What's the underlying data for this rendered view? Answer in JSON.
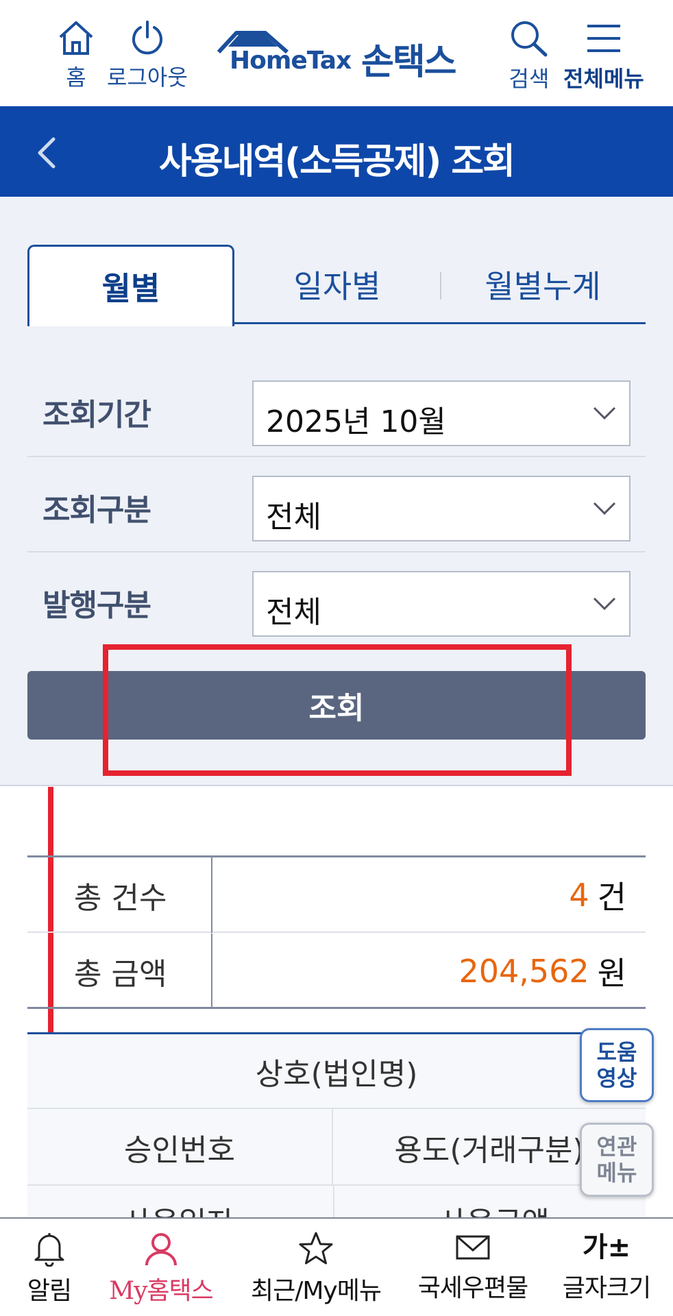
{
  "header": {
    "home_label": "홈",
    "logout_label": "로그아웃",
    "logo_text": "HomeTax",
    "logo_kr": "손택스",
    "search_label": "검색",
    "menu_label": "전체메뉴"
  },
  "title_bar": {
    "title": "사용내역(소득공제) 조회"
  },
  "tabs": [
    {
      "label": "월별",
      "active": true
    },
    {
      "label": "일자별",
      "active": false
    },
    {
      "label": "월별누계",
      "active": false
    }
  ],
  "filters": {
    "period": {
      "label": "조회기간",
      "value": "2025년 10월"
    },
    "type": {
      "label": "조회구분",
      "value": "전체"
    },
    "issue": {
      "label": "발행구분",
      "value": "전체"
    }
  },
  "search_button": "조회",
  "summary": {
    "count_label": "총 건수",
    "count_value": "4",
    "count_unit": "건",
    "amount_label": "총 금액",
    "amount_value": "204,562",
    "amount_unit": "원"
  },
  "list_header": {
    "merchant": "상호(법인명)",
    "approval_no": "승인번호",
    "usage": "용도(거래구분)",
    "used_date": "사용일자",
    "used_amount": "사용금액"
  },
  "floating": {
    "help_line1": "도움",
    "help_line2": "영상",
    "related_line1": "연관",
    "related_line2": "메뉴"
  },
  "bottom_nav": {
    "alarm": "알림",
    "my_hometax": "My홈택스",
    "recent": "최근/My메뉴",
    "mail": "국세우편물",
    "font_glyph": "가±",
    "font_size": "글자크기"
  },
  "colors": {
    "brand_blue": "#0d47a9",
    "accent_orange": "#e8660f",
    "highlight_red": "#e52331",
    "active_pink": "#d93a63"
  }
}
